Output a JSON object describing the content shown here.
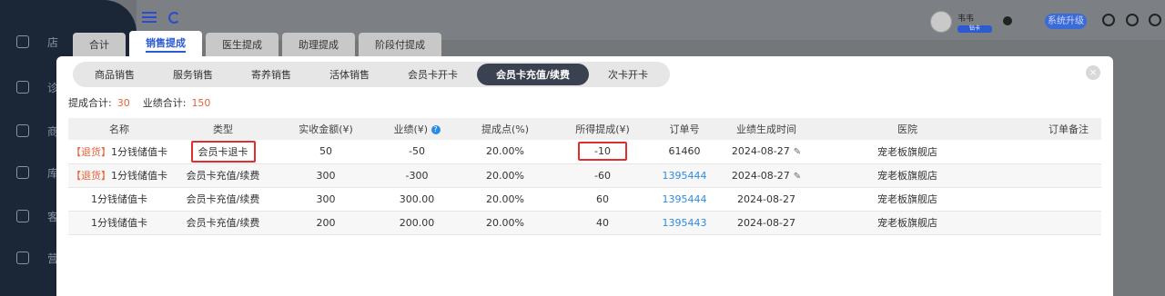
{
  "sidebar": {
    "items": [
      {
        "icon": "home-icon",
        "label": "店"
      },
      {
        "icon": "briefcase-icon",
        "label": "诊"
      },
      {
        "icon": "bag-icon",
        "label": "商"
      },
      {
        "icon": "box-icon",
        "label": "库"
      },
      {
        "icon": "user-icon",
        "label": "客"
      },
      {
        "icon": "chart-icon",
        "label": "营"
      }
    ]
  },
  "header": {
    "user_name": "韦韦",
    "user_badge": "钻卡",
    "upgrade_label": "系统升级"
  },
  "outer_tabs": [
    {
      "label": "合计",
      "active": false
    },
    {
      "label": "销售提成",
      "active": true
    },
    {
      "label": "医生提成",
      "active": false
    },
    {
      "label": "助理提成",
      "active": false
    },
    {
      "label": "阶段付提成",
      "active": false
    }
  ],
  "modal": {
    "close_label": "×",
    "sub_tabs": [
      {
        "label": "商品销售",
        "active": false
      },
      {
        "label": "服务销售",
        "active": false
      },
      {
        "label": "寄养销售",
        "active": false
      },
      {
        "label": "活体销售",
        "active": false
      },
      {
        "label": "会员卡开卡",
        "active": false
      },
      {
        "label": "会员卡充值/续费",
        "active": true
      },
      {
        "label": "次卡开卡",
        "active": false
      }
    ],
    "summary": {
      "commission_label": "提成合计:",
      "commission_value": "30",
      "performance_label": "业绩合计:",
      "performance_value": "150"
    },
    "table": {
      "headers": [
        "名称",
        "类型",
        "实收金额(¥)",
        "业绩(¥)",
        "提成点(%)",
        "所得提成(¥)",
        "订单号",
        "业绩生成时间",
        "医院",
        "订单备注"
      ],
      "rows": [
        {
          "tag": "【退货】",
          "name": "1分钱储值卡",
          "type": "会员卡退卡",
          "amount": "50",
          "performance": "-50",
          "rate": "20.00%",
          "commission": "-10",
          "order": "61460",
          "order_link": false,
          "time": "2024-08-27",
          "editable": true,
          "hospital": "宠老板旗舰店",
          "note": ""
        },
        {
          "tag": "【退货】",
          "name": "1分钱储值卡",
          "type": "会员卡充值/续费",
          "amount": "300",
          "performance": "-300",
          "rate": "20.00%",
          "commission": "-60",
          "order": "1395444",
          "order_link": true,
          "time": "2024-08-27",
          "editable": true,
          "hospital": "宠老板旗舰店",
          "note": ""
        },
        {
          "tag": "",
          "name": "1分钱储值卡",
          "type": "会员卡充值/续费",
          "amount": "300",
          "performance": "300.00",
          "rate": "20.00%",
          "commission": "60",
          "order": "1395444",
          "order_link": true,
          "time": "2024-08-27",
          "editable": false,
          "hospital": "宠老板旗舰店",
          "note": ""
        },
        {
          "tag": "",
          "name": "1分钱储值卡",
          "type": "会员卡充值/续费",
          "amount": "200",
          "performance": "200.00",
          "rate": "20.00%",
          "commission": "40",
          "order": "1395443",
          "order_link": true,
          "time": "2024-08-27",
          "editable": false,
          "hospital": "宠老板旗舰店",
          "note": ""
        }
      ]
    }
  },
  "colors": {
    "accent": "#2c5bd1",
    "active_tab": "#3a4252",
    "highlight_box": "#e02d2d",
    "return_tag": "#e8623a",
    "link": "#2d8ce0"
  }
}
